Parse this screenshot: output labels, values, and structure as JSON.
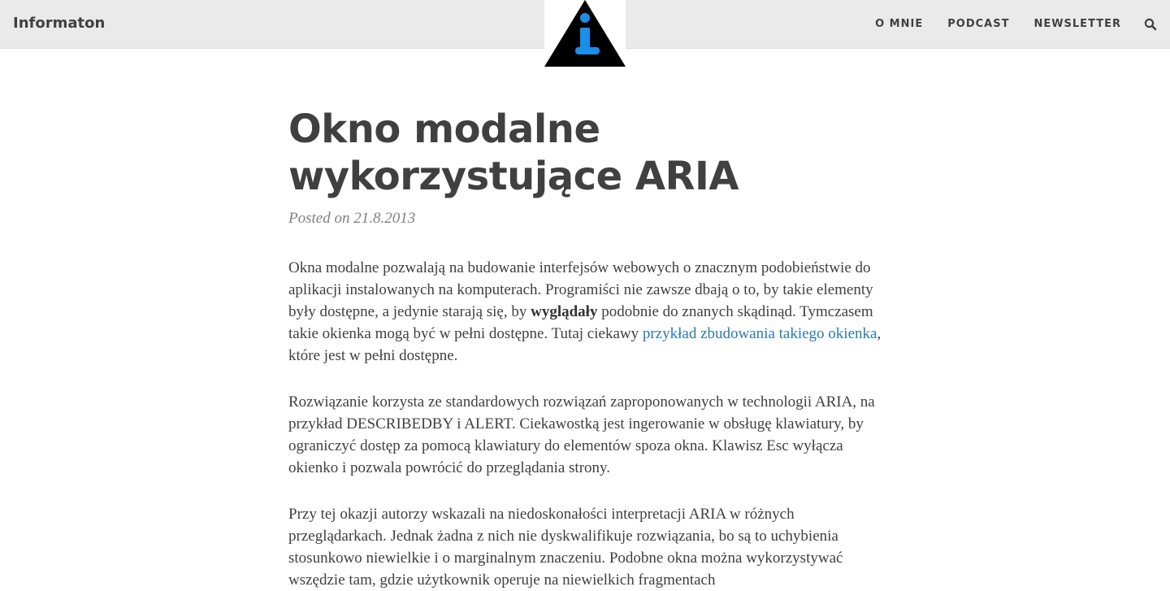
{
  "nav": {
    "brand": "Informaton",
    "links": [
      "O MNIE",
      "PODCAST",
      "NEWSLETTER"
    ],
    "search_icon": "search-icon",
    "logo_icon": "info-triangle-logo"
  },
  "post": {
    "title": "Okno modalne wykorzystujące ARIA",
    "meta_prefix": "Posted on",
    "date": "21.8.2013",
    "p1": {
      "a": "Okna modalne pozwalają na budowanie interfejsów webowych o znacznym podobieństwie do aplikacji instalowanych na komputerach. Programiści nie zawsze dbają o to, by takie elementy były dostępne, a jedynie starają się, by ",
      "bold": "wyglądały",
      "b": " podobnie do znanych skądinąd. Tymczasem takie okienka mogą być w pełni dostępne. Tutaj ciekawy ",
      "link": "przykład zbudowania takiego okienka",
      "c": ", które jest w pełni dostępne."
    },
    "p2": "Rozwiązanie korzysta ze standardowych rozwiązań zaproponowanych w technologii ARIA, na przykład DESCRIBEDBY i ALERT. Ciekawostką jest ingerowanie w obsługę klawiatury, by ograniczyć dostęp za pomocą klawiatury do elementów spoza okna. Klawisz Esc wyłącza okienko i pozwala powrócić do przeglądania strony.",
    "p3": "Przy tej okazji autorzy wskazali na niedoskonałości interpretacji ARIA w różnych przeglądarkach. Jednak żadna z nich nie dyskwalifikuje rozwiązania, bo są to uchybienia stosunkowo niewielkie i o marginalnym znaczeniu. Podobne okna można wykorzystywać wszędzie tam, gdzie użytkownik operuje na niewielkich fragmentach"
  },
  "colors": {
    "navbar_bg": "#eaeaea",
    "text": "#404040",
    "link": "#2a7ab0",
    "logo_accent": "#1a8fe8"
  }
}
